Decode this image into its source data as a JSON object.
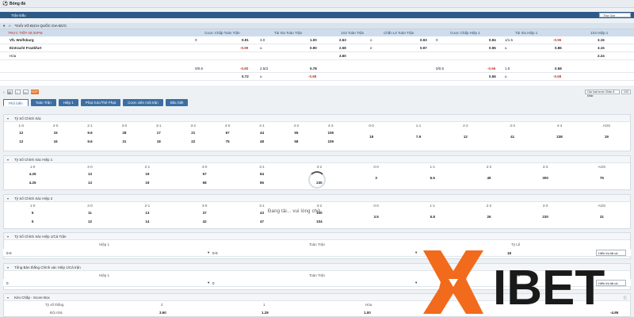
{
  "topbar": {
    "title": "Bóng đá"
  },
  "section": {
    "title": "Trận Đấu",
    "sort": "Thứ Giờ"
  },
  "league": {
    "name": "*GIẢI VÔ ĐỊCH QUỐC GIA ĐỨC"
  },
  "live": {
    "label": "TRỰC TIẾP 08:30PM",
    "headers": [
      "Cược Chấp Toàn Trận",
      "Tài Xỉu Toàn Trận",
      "1X2 Toàn Trận",
      "Chẵn Lẻ Toàn Trận",
      "Cược Chấp Hiệp 1",
      "Tài Xỉu Hiệp 1",
      "1X2 Hiệp 1"
    ]
  },
  "match": {
    "team1": "VfL Wolfsburg",
    "team2": "Eintracht Frankfurt",
    "draw": "Hòa",
    "r1": {
      "ah_line": "0",
      "ah": "0.91",
      "ou_line": "3.0",
      "ou": "1.00",
      "x12": "2.63",
      "oe_l": "o",
      "oe": "0.93",
      "h1_line": "0",
      "h1": "0.94",
      "h1ou_line": "1/1.5",
      "h1ou": "-0.96",
      "h1x": "3.15"
    },
    "r2": {
      "ah": "-0.99",
      "ou_line": "u",
      "ou": "0.90",
      "x12": "2.58",
      "oe_l": "e",
      "oe": "0.97",
      "h1": "0.96",
      "h1ou_line": "u",
      "h1ou": "0.86",
      "h1x": "3.15"
    },
    "r3": {
      "x12": "3.60",
      "h1x": "2.24"
    },
    "r4": {
      "ah_line": "0/0.5",
      "ah": "-0.80",
      "ou_line": "2.5/3",
      "ou": "0.78",
      "h1_line": "0/0.5",
      "h1": "-0.66",
      "h1ou_line": "1.0",
      "h1ou": "0.58"
    },
    "r5": {
      "ah": "0.72",
      "ou_line": "u",
      "ou": "-0.88",
      "h1": "0.56",
      "h1ou_line": "u",
      "h1ou": "-0.68"
    }
  },
  "ctrl": {
    "sgp": "SGP",
    "market_select": "Các loại cược Châu Á khác",
    "count_select": "1X2"
  },
  "tabs": [
    "Phổ biến",
    "Toàn Trận",
    "Hiệp 1",
    "Phạt Góc/Thẻ Phạt",
    "Cược xiên một trận",
    "Đặc biệt"
  ],
  "cs": {
    "title": "Tỷ Số Chính Xác",
    "home_heads": [
      "1-0",
      "2-0",
      "2-1",
      "3-0",
      "3-1",
      "3-2",
      "4-0",
      "4-1",
      "4-2",
      "4-3"
    ],
    "home_r1": [
      "12",
      "15",
      "9.6",
      "28",
      "17",
      "21",
      "67",
      "44",
      "55",
      "106"
    ],
    "home_r2": [
      "12",
      "16",
      "9.6",
      "31",
      "18",
      "22",
      "75",
      "48",
      "58",
      "109"
    ],
    "draw_heads": [
      "0-0",
      "1-1",
      "2-2",
      "3-3",
      "4-4",
      "AOS"
    ],
    "draw_vals": [
      "18",
      "7.9",
      "12",
      "41",
      "238",
      "19"
    ]
  },
  "csh1": {
    "title": "Tỷ Số Chính Xác Hiệp 1",
    "home_heads": [
      "1-0",
      "2-0",
      "2-1",
      "3-0",
      "3-1",
      "3-2"
    ],
    "home_r1": [
      "4.25",
      "13",
      "19",
      "57",
      "84",
      ""
    ],
    "home_r2": [
      "4.25",
      "13",
      "19",
      "58",
      "85",
      "230"
    ],
    "draw_heads": [
      "0-0",
      "1-1",
      "2-2",
      "3-3",
      "AOS"
    ],
    "draw_vals": [
      "3",
      "6.5",
      "49",
      "300",
      "75"
    ]
  },
  "csh2": {
    "title": "Tỷ Số Chính Xác Hiệp 2",
    "home_heads": [
      "1-0",
      "2-0",
      "2-1",
      "3-0",
      "3-1",
      "3-2"
    ],
    "home_r1": [
      "5",
      "11",
      "13",
      "37",
      "43",
      "100"
    ],
    "home_r2": [
      "5",
      "12",
      "14",
      "42",
      "47",
      "104"
    ],
    "draw_heads": [
      "0-0",
      "1-1",
      "2-2",
      "3-3",
      "AOS"
    ],
    "draw_vals": [
      "3.5",
      "5.8",
      "26",
      "230",
      "31"
    ]
  },
  "loading": "Đang tải... vui lòng chờ.",
  "htft": {
    "title": "Tỷ Số Chính Xác Hiệp 1/Cả Trận",
    "h1": "Hiệp 1",
    "ft": "Toàn Trận",
    "odds": "Tỷ Lệ",
    "v1": "0-0",
    "v2": "0-0",
    "odds_val": "18",
    "show_all": "Hiển thị tất cả"
  },
  "tg": {
    "title": "Tổng Bàn thắng Chính xác Hiệp 1/Cả trận",
    "h1": "Hiệp 1",
    "ft": "Toàn Trận",
    "odds": "Tỷ Lệ",
    "v1": "0",
    "v2": "0",
    "show_all": "Hiển thị tất cả"
  },
  "sb": {
    "title": "Kèo Chấp - Score Box",
    "lbl": "Tỷ số thắng",
    "c1": "2",
    "c2": "1",
    "c3": "Hòa",
    "row": "Đội nhà",
    "v1": "3.60",
    "v2": "1.29",
    "v3": "1.00",
    "v4": "-4.95"
  },
  "logo_text": "IBET",
  "colors": {
    "header": "#2e5a88",
    "accent": "#e8772e",
    "logo_orange": "#f26a1b"
  }
}
